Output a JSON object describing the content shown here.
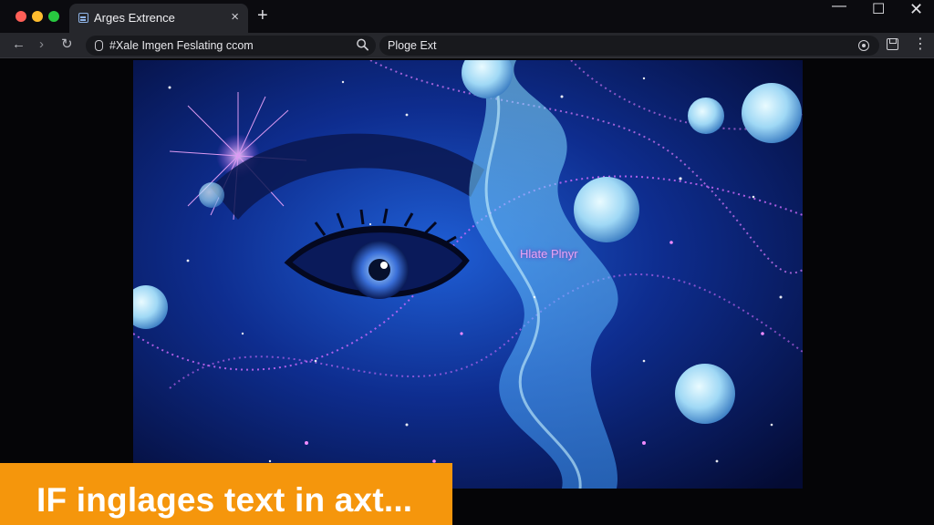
{
  "window": {
    "colors": {
      "close": "#ff5f57",
      "minimize": "#febc2e",
      "zoom": "#28c840"
    },
    "controls": {
      "minimize": "—",
      "maximize": "☐",
      "close": "✕"
    }
  },
  "tab": {
    "title": "Arges Extrence",
    "close": "×",
    "icon": "grid-favicon-icon"
  },
  "new_tab": "+",
  "toolbar": {
    "back": "←",
    "forward": "›",
    "reload": "↻",
    "url": "#Xale Imgen Feslating ccom",
    "extension_field": "Ploge Ext"
  },
  "artwork": {
    "caption": "Hlate Plnyr",
    "description_colors": {
      "deep": "#081a5c",
      "nebula": "#4fa8ff",
      "accent": "#e06cff"
    }
  },
  "banner": {
    "text": "IF inglages text in axt...",
    "color": "#f5960c"
  }
}
